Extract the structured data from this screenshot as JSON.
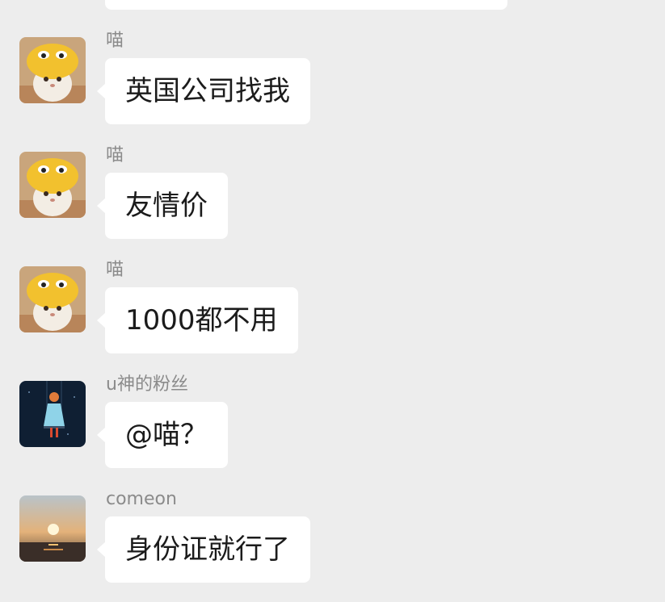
{
  "messages": [
    {
      "sender": "喵",
      "text": "英国公司找我",
      "avatar": "cat-duck-hat-icon"
    },
    {
      "sender": "喵",
      "text": "友情价",
      "avatar": "cat-duck-hat-icon"
    },
    {
      "sender": "喵",
      "text": "1000都不用",
      "avatar": "cat-duck-hat-icon"
    },
    {
      "sender": "u神的粉丝",
      "text": "@喵？",
      "avatar": "girl-on-swing-icon"
    },
    {
      "sender": "comeon",
      "text": "身份证就行了",
      "avatar": "sunset-icon"
    }
  ],
  "colors": {
    "background": "#ededed",
    "bubble": "#ffffff",
    "sender_text": "#8b8b8b",
    "message_text": "#1b1b1b"
  }
}
